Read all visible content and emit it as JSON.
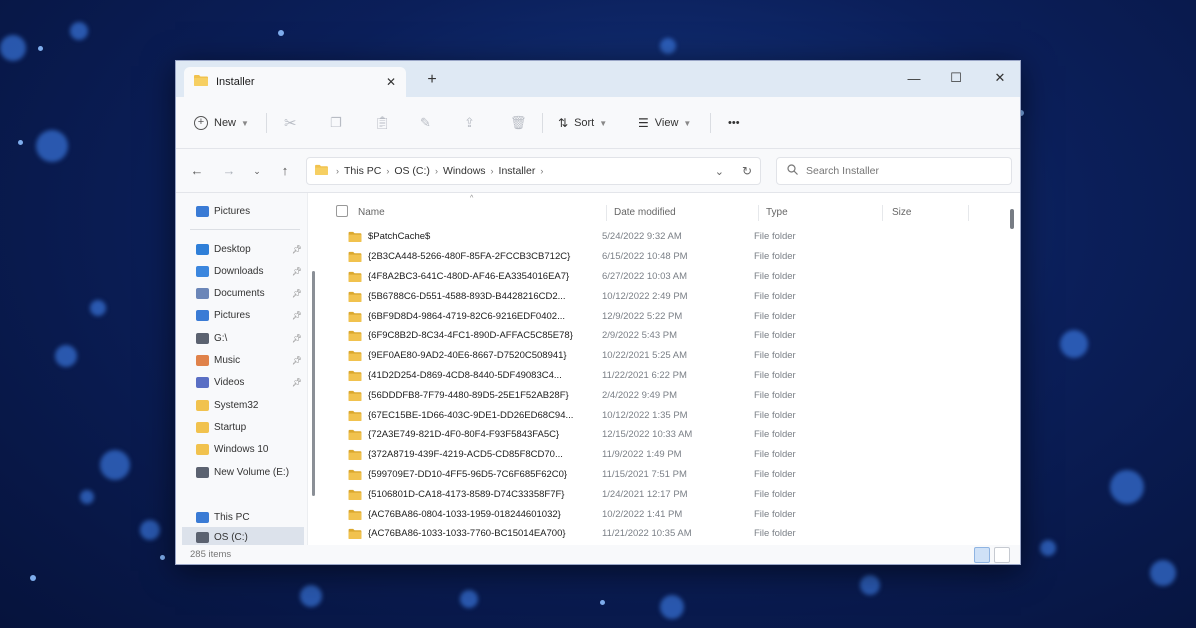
{
  "tab": {
    "title": "Installer",
    "close": "✕",
    "new_tab": "+"
  },
  "window_controls": {
    "minimize": "—",
    "maximize": "☐",
    "close": "✕"
  },
  "toolbar": {
    "new_label": "New",
    "sort_label": "Sort",
    "view_label": "View",
    "more_label": "•••"
  },
  "breadcrumb": [
    "This PC",
    "OS (C:)",
    "Windows",
    "Installer"
  ],
  "search": {
    "placeholder": "Search Installer"
  },
  "sidebar": {
    "top_item": "Pictures",
    "items": [
      {
        "label": "Desktop",
        "pinned": true,
        "icon": "desktop-icon"
      },
      {
        "label": "Downloads",
        "pinned": true,
        "icon": "download-icon"
      },
      {
        "label": "Documents",
        "pinned": true,
        "icon": "document-icon"
      },
      {
        "label": "Pictures",
        "pinned": true,
        "icon": "pictures-icon"
      },
      {
        "label": "G:\\",
        "pinned": true,
        "icon": "drive-icon"
      },
      {
        "label": "Music",
        "pinned": true,
        "icon": "music-icon"
      },
      {
        "label": "Videos",
        "pinned": true,
        "icon": "video-icon"
      },
      {
        "label": "System32",
        "pinned": false,
        "icon": "folder-icon"
      },
      {
        "label": "Startup",
        "pinned": false,
        "icon": "folder-icon"
      },
      {
        "label": "Windows 10",
        "pinned": false,
        "icon": "folder-icon"
      },
      {
        "label": "New Volume (E:)",
        "pinned": false,
        "icon": "drive-icon"
      }
    ],
    "this_pc": "This PC",
    "os_drive": "OS (C:)"
  },
  "columns": {
    "name": "Name",
    "date": "Date modified",
    "type": "Type",
    "size": "Size"
  },
  "files": [
    {
      "name": "$PatchCache$",
      "date": "5/24/2022 9:32 AM",
      "type": "File folder"
    },
    {
      "name": "{2B3CA448-5266-480F-85FA-2FCCB3CB712C}",
      "date": "6/15/2022 10:48 PM",
      "type": "File folder"
    },
    {
      "name": "{4F8A2BC3-641C-480D-AF46-EA3354016EA7}",
      "date": "6/27/2022 10:03 AM",
      "type": "File folder"
    },
    {
      "name": "{5B6788C6-D551-4588-893D-B4428216CD2...",
      "date": "10/12/2022 2:49 PM",
      "type": "File folder"
    },
    {
      "name": "{6BF9D8D4-9864-4719-82C6-9216EDF0402...",
      "date": "12/9/2022 5:22 PM",
      "type": "File folder"
    },
    {
      "name": "{6F9C8B2D-8C34-4FC1-890D-AFFAC5C85E78}",
      "date": "2/9/2022 5:43 PM",
      "type": "File folder"
    },
    {
      "name": "{9EF0AE80-9AD2-40E6-8667-D7520C508941}",
      "date": "10/22/2021 5:25 AM",
      "type": "File folder"
    },
    {
      "name": "{41D2D254-D869-4CD8-8440-5DF49083C4...",
      "date": "11/22/2021 6:22 PM",
      "type": "File folder"
    },
    {
      "name": "{56DDDFB8-7F79-4480-89D5-25E1F52AB28F}",
      "date": "2/4/2022 9:49 PM",
      "type": "File folder"
    },
    {
      "name": "{67EC15BE-1D66-403C-9DE1-DD26ED68C94...",
      "date": "10/12/2022 1:35 PM",
      "type": "File folder"
    },
    {
      "name": "{72A3E749-821D-4F0-80F4-F93F5843FA5C}",
      "date": "12/15/2022 10:33 AM",
      "type": "File folder"
    },
    {
      "name": "{372A8719-439F-4219-ACD5-CD85F8CD70...",
      "date": "11/9/2022 1:49 PM",
      "type": "File folder"
    },
    {
      "name": "{599709E7-DD10-4FF5-96D5-7C6F685F62C0}",
      "date": "11/15/2021 7:51 PM",
      "type": "File folder"
    },
    {
      "name": "{5106801D-CA18-4173-8589-D74C33358F7F}",
      "date": "1/24/2021 12:17 PM",
      "type": "File folder"
    },
    {
      "name": "{AC76BA86-0804-1033-1959-018244601032}",
      "date": "10/2/2022 1:41 PM",
      "type": "File folder"
    },
    {
      "name": "{AC76BA86-1033-1033-7760-BC15014EA700}",
      "date": "11/21/2022 10:35 AM",
      "type": "File folder"
    }
  ],
  "status": {
    "item_count": "285 items"
  },
  "colors": {
    "accent": "#0067c0",
    "folder": "#f1c24e",
    "folder_dark": "#dba82e"
  }
}
